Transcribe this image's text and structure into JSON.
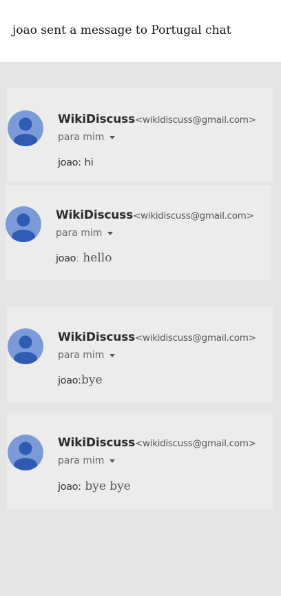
{
  "page": {
    "title": "joao sent a message to Portugal chat"
  },
  "messages": [
    {
      "sender": "WikiDiscuss",
      "email": "<wikidiscuss@gmail.com>",
      "recipient": "para mim",
      "author": "joao",
      "separator": ":",
      "text": " hi",
      "dropdown_icon": "caret-down-icon",
      "avatar_icon": "default-user-avatar"
    },
    {
      "sender": "WikiDiscuss",
      "email": "<wikidiscuss@gmail.com>",
      "recipient": "para mim",
      "author": "joao",
      "separator": ":",
      "text": " hello",
      "dropdown_icon": "caret-down-icon",
      "avatar_icon": "default-user-avatar"
    },
    {
      "sender": "WikiDiscuss",
      "email": "<wikidiscuss@gmail.com>",
      "recipient": "para mim",
      "author": "joao",
      "separator": ":",
      "text": "bye",
      "dropdown_icon": "caret-down-icon",
      "avatar_icon": "default-user-avatar"
    },
    {
      "sender": "WikiDiscuss",
      "email": "<wikidiscuss@gmail.com>",
      "recipient": "para mim",
      "author": "joao",
      "separator": ":",
      "text": " bye bye",
      "dropdown_icon": "caret-down-icon",
      "avatar_icon": "default-user-avatar"
    }
  ],
  "colors": {
    "avatar_background": "#7a9bd8",
    "avatar_figure": "#2f5bb3",
    "card_background": "#ececec",
    "page_background": "#e5e5e5",
    "header_background": "#ffffff"
  }
}
